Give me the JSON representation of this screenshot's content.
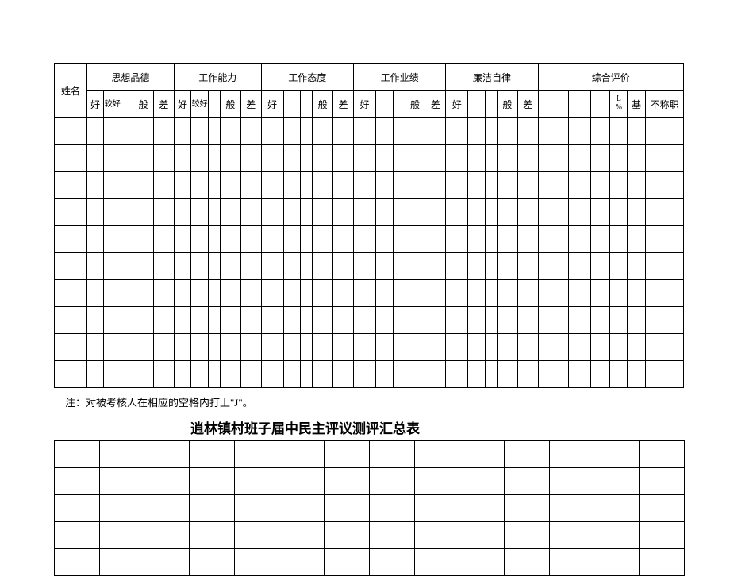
{
  "table1": {
    "colA": "姓名",
    "g1": "思想品德",
    "g2": "工作能力",
    "g3": "工作态度",
    "g4": "工作业绩",
    "g5": "廉洁自律",
    "g6": "综合评价",
    "s_hao": "好",
    "s_jiaohao": "较好",
    "s_ban": "般",
    "s_cha": "差",
    "s_L3": "L%",
    "s_ji": "基",
    "s_buchengzhi": "不称职"
  },
  "note": "注：对被考核人在相应的空格内打上\"J\"。",
  "title2": "逍林镇村班子届中民主评议测评汇总表",
  "table2_rows": 5
}
